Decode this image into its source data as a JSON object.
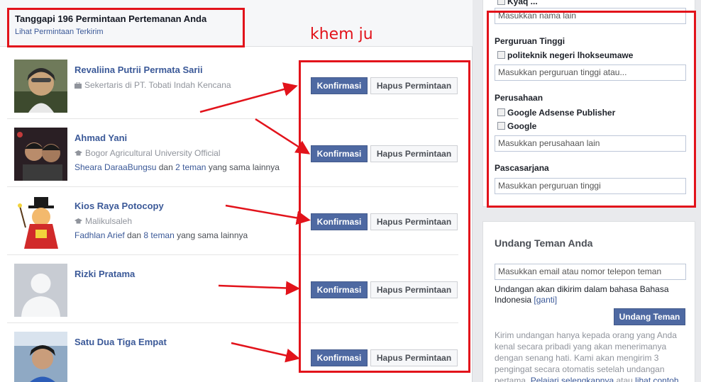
{
  "header": {
    "title": "Tanggapi 196 Permintaan Pertemanan Anda",
    "link": "Lihat Permintaan Terkirim"
  },
  "annotation": {
    "label": "khem ju",
    "color": "#e2131b"
  },
  "requests": [
    {
      "name": "Revaliina Putrii Permata Sarii",
      "sub_icon": "briefcase-icon",
      "subtitle": "Sekertaris di PT. Tobati Indah Kencana",
      "mutual_name": "",
      "mutual_mid": "",
      "mutual_link": "",
      "mutual_end": "",
      "confirm": "Konfirmasi",
      "delete": "Hapus Permintaan"
    },
    {
      "name": "Ahmad Yani",
      "sub_icon": "graduation-cap-icon",
      "subtitle": "Bogor Agricultural University Official",
      "mutual_name": "Sheara DaraaBungsu",
      "mutual_mid": " dan ",
      "mutual_link": "2 teman",
      "mutual_end": " yang sama lainnya",
      "confirm": "Konfirmasi",
      "delete": "Hapus Permintaan"
    },
    {
      "name": "Kios Raya Potocopy",
      "sub_icon": "graduation-cap-icon",
      "subtitle": "Malikulsaleh",
      "mutual_name": "Fadhlan Arief",
      "mutual_mid": " dan ",
      "mutual_link": "8 teman",
      "mutual_end": " yang sama lainnya",
      "confirm": "Konfirmasi",
      "delete": "Hapus Permintaan"
    },
    {
      "name": "Rizki Pratama",
      "sub_icon": "",
      "subtitle": "",
      "mutual_name": "",
      "mutual_mid": "",
      "mutual_link": "",
      "mutual_end": "",
      "confirm": "Konfirmasi",
      "delete": "Hapus Permintaan"
    },
    {
      "name": "Satu Dua Tiga Empat",
      "sub_icon": "",
      "subtitle": "",
      "mutual_name": "",
      "mutual_mid": "",
      "mutual_link": "",
      "mutual_end": "",
      "confirm": "Konfirmasi",
      "delete": "Hapus Permintaan"
    }
  ],
  "filters": {
    "top_partial_label": "Kyaq ...",
    "name_placeholder": "Masukkan nama lain",
    "college": {
      "title": "Perguruan Tinggi",
      "option": "politeknik negeri lhokseumawe",
      "placeholder": "Masukkan perguruan tinggi atau..."
    },
    "company": {
      "title": "Perusahaan",
      "options": [
        "Google Adsense Publisher",
        "Google"
      ],
      "placeholder": "Masukkan perusahaan lain"
    },
    "grad": {
      "title": "Pascasarjana",
      "placeholder": "Masukkan perguruan tinggi"
    }
  },
  "invite": {
    "title": "Undang Teman Anda",
    "placeholder": "Masukkan email atau nomor telepon teman",
    "note": "Undangan akan dikirim dalam bahasa Bahasa Indonesia",
    "note_link": "[ganti]",
    "button": "Undang Teman",
    "help": "Kirim undangan hanya kepada orang yang Anda kenal secara pribadi yang akan menerimanya dengan senang hati. Kami akan mengirim 3 pengingat secara otomatis setelah undangan pertama.",
    "help_link1": "Pelajari selengkapnya",
    "help_mid": " atau ",
    "help_link2": "lihat contoh"
  }
}
